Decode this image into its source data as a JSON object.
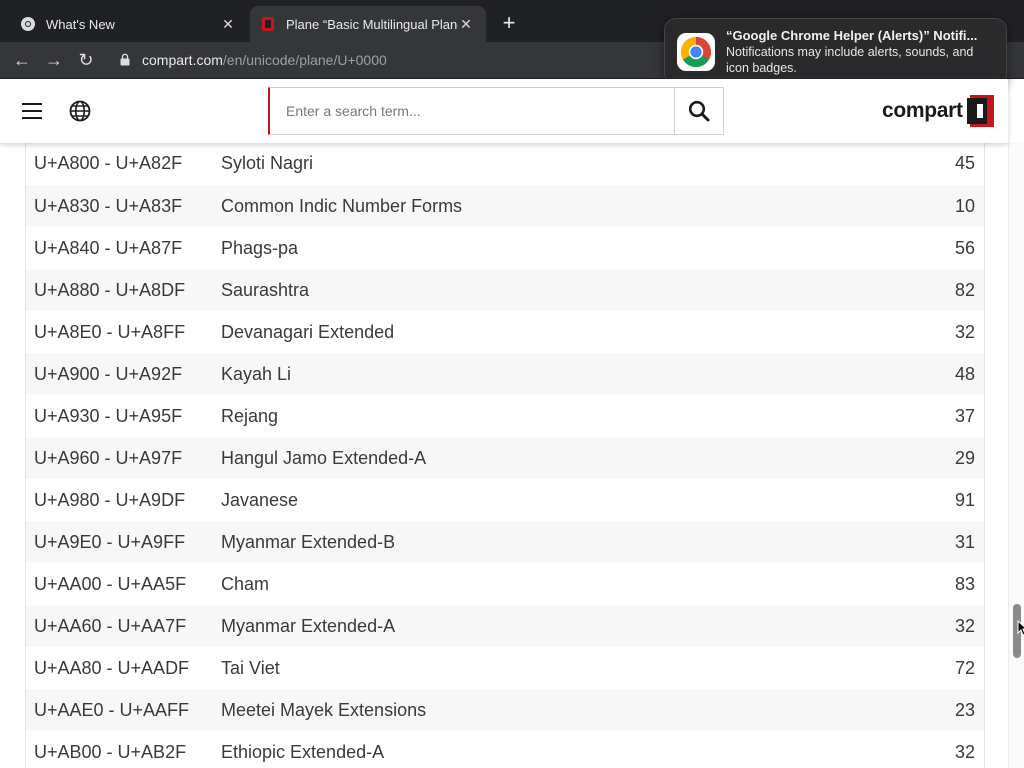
{
  "browser": {
    "tabs": [
      {
        "title": "What's New",
        "favicon": "chrome-favicon-icon",
        "active": false
      },
      {
        "title": "Plane “Basic Multilingual Plane”",
        "favicon": "compart-favicon-icon",
        "active": true
      }
    ],
    "address": {
      "domain": "compart.com",
      "path": "/en/unicode/plane/U+0000"
    }
  },
  "notification": {
    "title": "“Google Chrome Helper (Alerts)” Notifi...",
    "body": "Notifications may include alerts, sounds, and icon badges.",
    "icon": "chrome-icon"
  },
  "header": {
    "search_placeholder": "Enter a search term...",
    "logo_text": "compart",
    "brand_color": "#c4161c"
  },
  "blocks": [
    {
      "range": "U+A800 - U+A82F",
      "name": "Syloti Nagri",
      "count": "45"
    },
    {
      "range": "U+A830 - U+A83F",
      "name": "Common Indic Number Forms",
      "count": "10"
    },
    {
      "range": "U+A840 - U+A87F",
      "name": "Phags-pa",
      "count": "56"
    },
    {
      "range": "U+A880 - U+A8DF",
      "name": "Saurashtra",
      "count": "82"
    },
    {
      "range": "U+A8E0 - U+A8FF",
      "name": "Devanagari Extended",
      "count": "32"
    },
    {
      "range": "U+A900 - U+A92F",
      "name": "Kayah Li",
      "count": "48"
    },
    {
      "range": "U+A930 - U+A95F",
      "name": "Rejang",
      "count": "37"
    },
    {
      "range": "U+A960 - U+A97F",
      "name": "Hangul Jamo Extended-A",
      "count": "29"
    },
    {
      "range": "U+A980 - U+A9DF",
      "name": "Javanese",
      "count": "91"
    },
    {
      "range": "U+A9E0 - U+A9FF",
      "name": "Myanmar Extended-B",
      "count": "31"
    },
    {
      "range": "U+AA00 - U+AA5F",
      "name": "Cham",
      "count": "83"
    },
    {
      "range": "U+AA60 - U+AA7F",
      "name": "Myanmar Extended-A",
      "count": "32"
    },
    {
      "range": "U+AA80 - U+AADF",
      "name": "Tai Viet",
      "count": "72"
    },
    {
      "range": "U+AAE0 - U+AAFF",
      "name": "Meetei Mayek Extensions",
      "count": "23"
    },
    {
      "range": "U+AB00 - U+AB2F",
      "name": "Ethiopic Extended-A",
      "count": "32"
    }
  ]
}
